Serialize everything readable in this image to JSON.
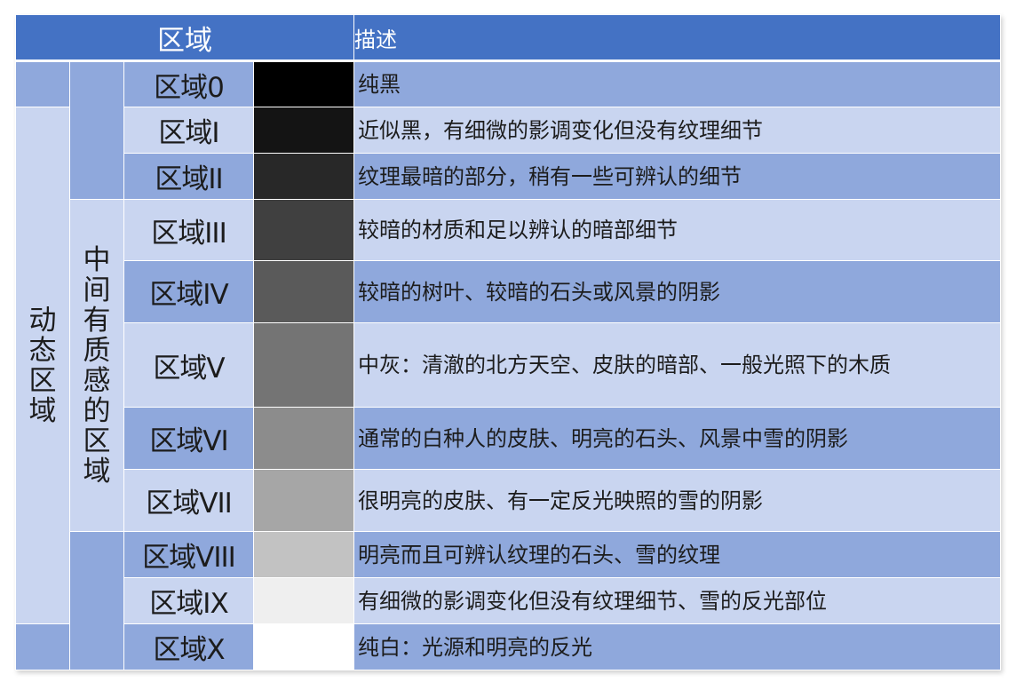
{
  "header": {
    "zone": "区域",
    "description": "描述"
  },
  "groups": {
    "dynamic": "动态区域",
    "texture": "中间有质感的区域"
  },
  "rows": [
    {
      "zone": "区域0",
      "color": "#000000",
      "description": "纯黑"
    },
    {
      "zone": "区域I",
      "color": "#141414",
      "description": "近似黑，有细微的影调变化但没有纹理细节"
    },
    {
      "zone": "区域II",
      "color": "#282828",
      "description": "纹理最暗的部分，稍有一些可辨认的细节"
    },
    {
      "zone": "区域III",
      "color": "#404040",
      "description": "较暗的材质和足以辨认的暗部细节"
    },
    {
      "zone": "区域IV",
      "color": "#5a5a5a",
      "description": "较暗的树叶、较暗的石头或风景的阴影"
    },
    {
      "zone": "区域V",
      "color": "#747474",
      "description": "中灰：清澈的北方天空、皮肤的暗部、一般光照下的木质"
    },
    {
      "zone": "区域VI",
      "color": "#8c8c8c",
      "description": "通常的白种人的皮肤、明亮的石头、风景中雪的阴影"
    },
    {
      "zone": "区域VII",
      "color": "#a6a6a6",
      "description": "很明亮的皮肤、有一定反光映照的雪的阴影"
    },
    {
      "zone": "区域VIII",
      "color": "#c2c2c2",
      "description": "明亮而且可辨认纹理的石头、雪的纹理"
    },
    {
      "zone": "区域IX",
      "color": "#efefef",
      "description": "有细微的影调变化但没有纹理细节、雪的反光部位"
    },
    {
      "zone": "区域X",
      "color": "#ffffff",
      "description": "纯白：光源和明亮的反光"
    }
  ],
  "colors": {
    "header": "#4472c4",
    "band_dark": "#8fa8dc",
    "band_light": "#c9d5f0"
  }
}
